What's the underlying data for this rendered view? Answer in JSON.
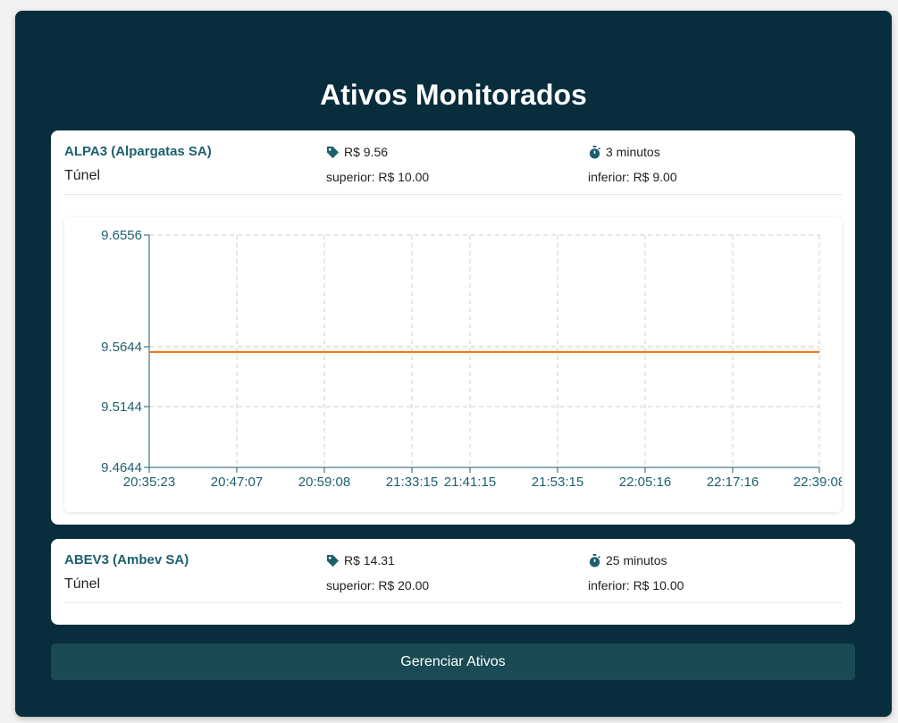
{
  "page": {
    "title": "Ativos Monitorados",
    "manage_button_label": "Gerenciar Ativos"
  },
  "assets": [
    {
      "name": "ALPA3 (Alpargatas SA)",
      "type": "Túnel",
      "price": "R$ 9.56",
      "upper": "superior: R$ 10.00",
      "interval": "3 minutos",
      "lower": "inferior: R$ 9.00",
      "price_icon": "tag-icon",
      "interval_icon": "stopwatch-icon"
    },
    {
      "name": "ABEV3 (Ambev SA)",
      "type": "Túnel",
      "price": "R$ 14.31",
      "upper": "superior: R$ 20.00",
      "interval": "25 minutos",
      "lower": "inferior: R$ 10.00",
      "price_icon": "tag-icon",
      "interval_icon": "stopwatch-icon"
    }
  ],
  "colors": {
    "panel_bg": "#082d3c",
    "accent": "#1e5f6e",
    "line": "#f26c0d",
    "button_bg": "#1a4a53"
  },
  "chart_data": {
    "type": "line",
    "title": "",
    "xlabel": "",
    "ylabel": "",
    "grid": true,
    "x": [
      "20:35:23",
      "20:47:07",
      "20:59:08",
      "21:33:15",
      "21:41:15",
      "21:53:15",
      "22:05:16",
      "22:17:16",
      "22:39:08"
    ],
    "y_ticks": [
      "9.6556",
      "9.5644",
      "9.5144",
      "9.4644"
    ],
    "ylim": [
      9.4644,
      9.6556
    ],
    "series": [
      {
        "values": [
          9.56,
          9.56,
          9.56,
          9.56,
          9.56,
          9.56,
          9.56,
          9.56,
          9.56
        ]
      }
    ]
  }
}
